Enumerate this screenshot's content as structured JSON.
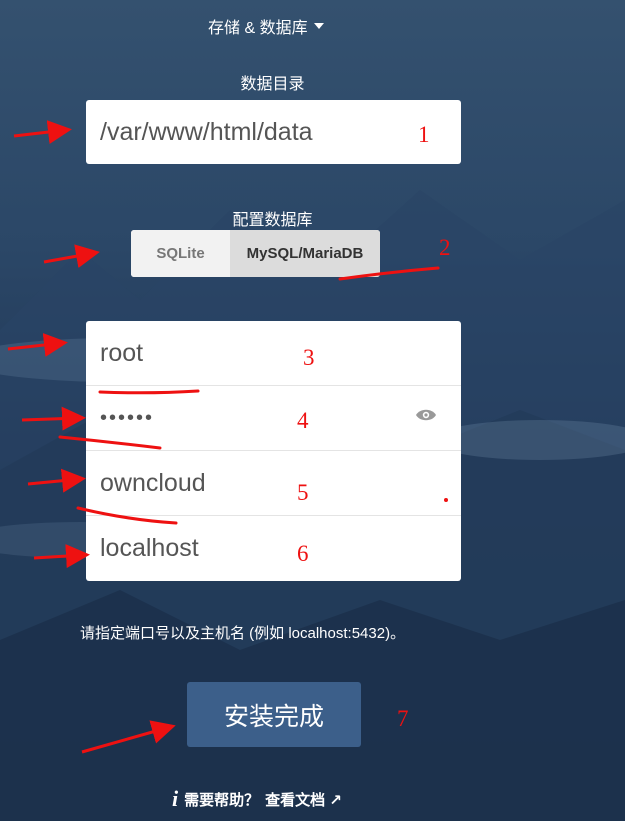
{
  "header": {
    "section_label": "存储 & 数据库"
  },
  "data_dir": {
    "label": "数据目录",
    "value": "/var/www/html/data"
  },
  "db_config": {
    "label": "配置数据库",
    "options": [
      "SQLite",
      "MySQL/MariaDB"
    ],
    "selected": "MySQL/MariaDB"
  },
  "db_fields": {
    "user": "root",
    "password": "••••••",
    "name": "owncloud",
    "host": "localhost"
  },
  "port_hint": "请指定端口号以及主机名 (例如 localhost:5432)。",
  "install_button": "安装完成",
  "help": {
    "text": "需要帮助？",
    "link": "查看文档 ↗"
  },
  "annotations": [
    "1",
    "2",
    "3",
    "4",
    "5",
    "6",
    "7"
  ],
  "colors": {
    "background": "#2b4767",
    "button": "#3c5f8a",
    "annotation": "#e11111"
  }
}
